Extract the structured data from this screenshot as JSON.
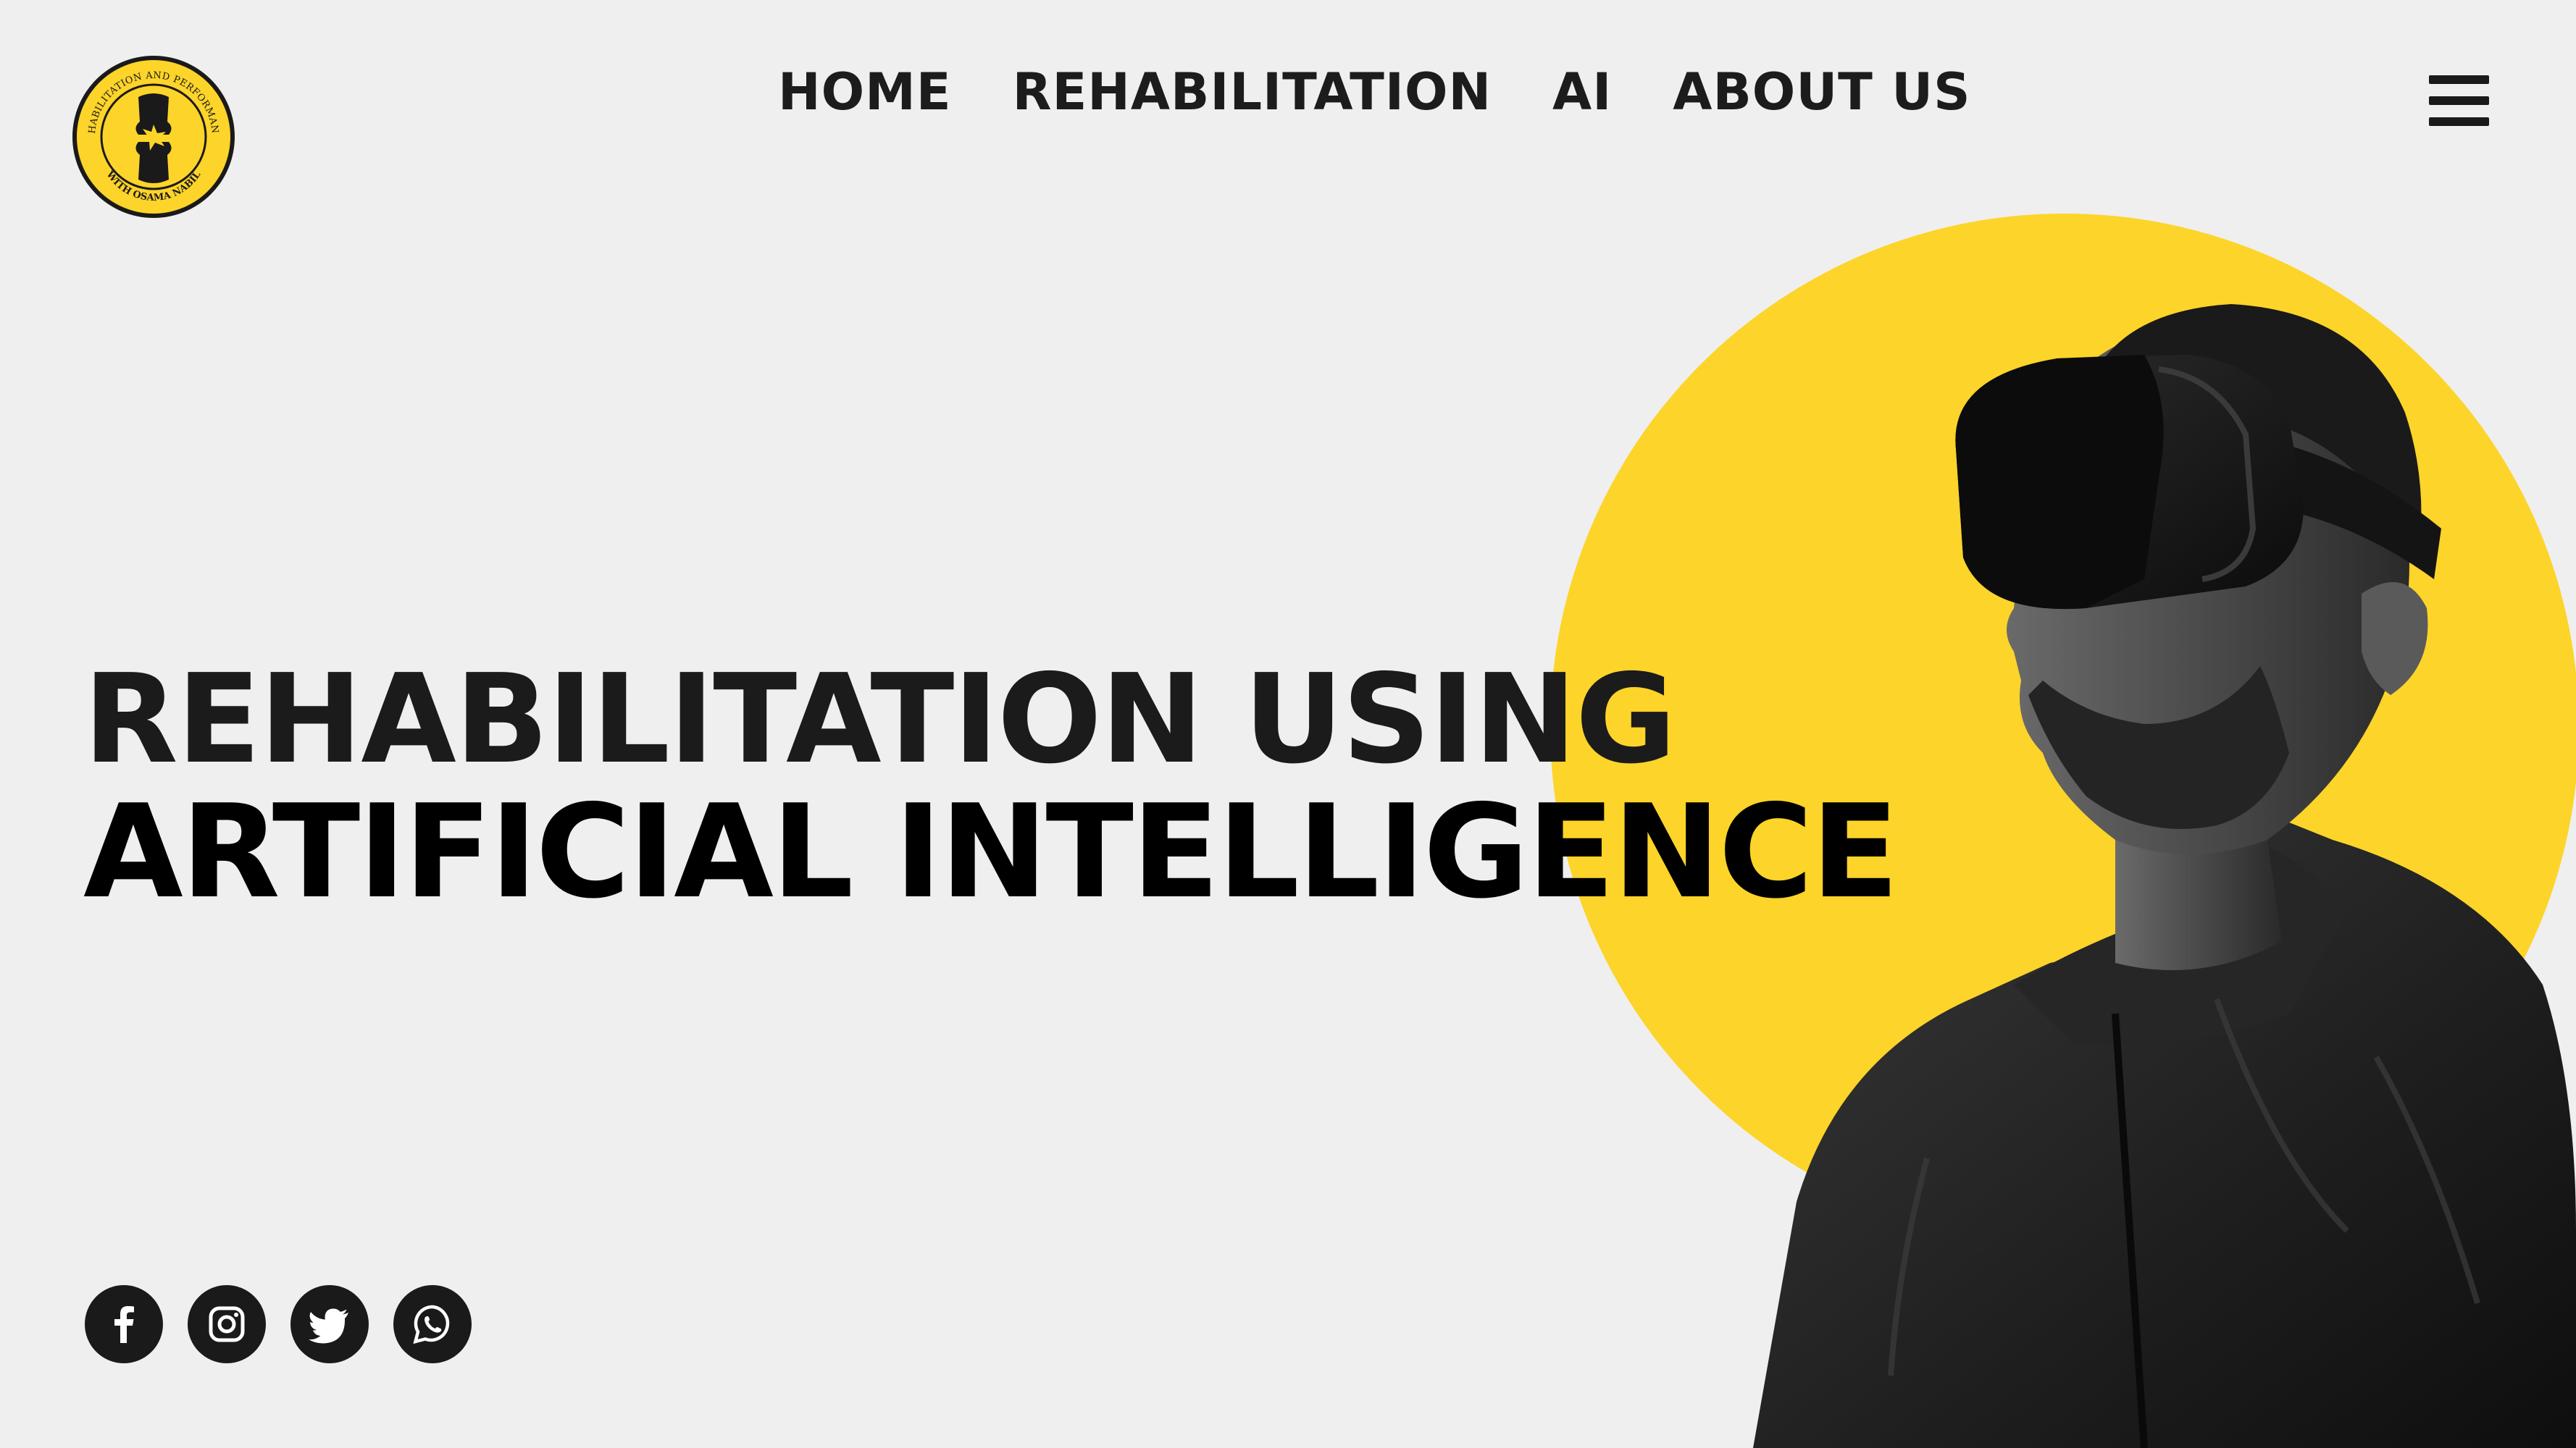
{
  "brand": {
    "logo_text_top": "REHABILITATION AND PERFORMANCE",
    "logo_text_bottom": "WITH OSAMA NABIL",
    "accent_color": "#fdd429"
  },
  "nav": {
    "items": [
      {
        "label": "HOME"
      },
      {
        "label": "REHABILITATION"
      },
      {
        "label": "AI"
      },
      {
        "label": "ABOUT US"
      }
    ],
    "menu_icon": "hamburger-menu-icon"
  },
  "hero": {
    "headline_line1": "REHABILITATION USING",
    "headline_line2": "ARTIFICIAL INTELLIGENCE",
    "image": "man-wearing-vr-headset"
  },
  "socials": [
    {
      "icon": "facebook-icon"
    },
    {
      "icon": "instagram-icon"
    },
    {
      "icon": "twitter-icon"
    },
    {
      "icon": "whatsapp-icon"
    }
  ]
}
